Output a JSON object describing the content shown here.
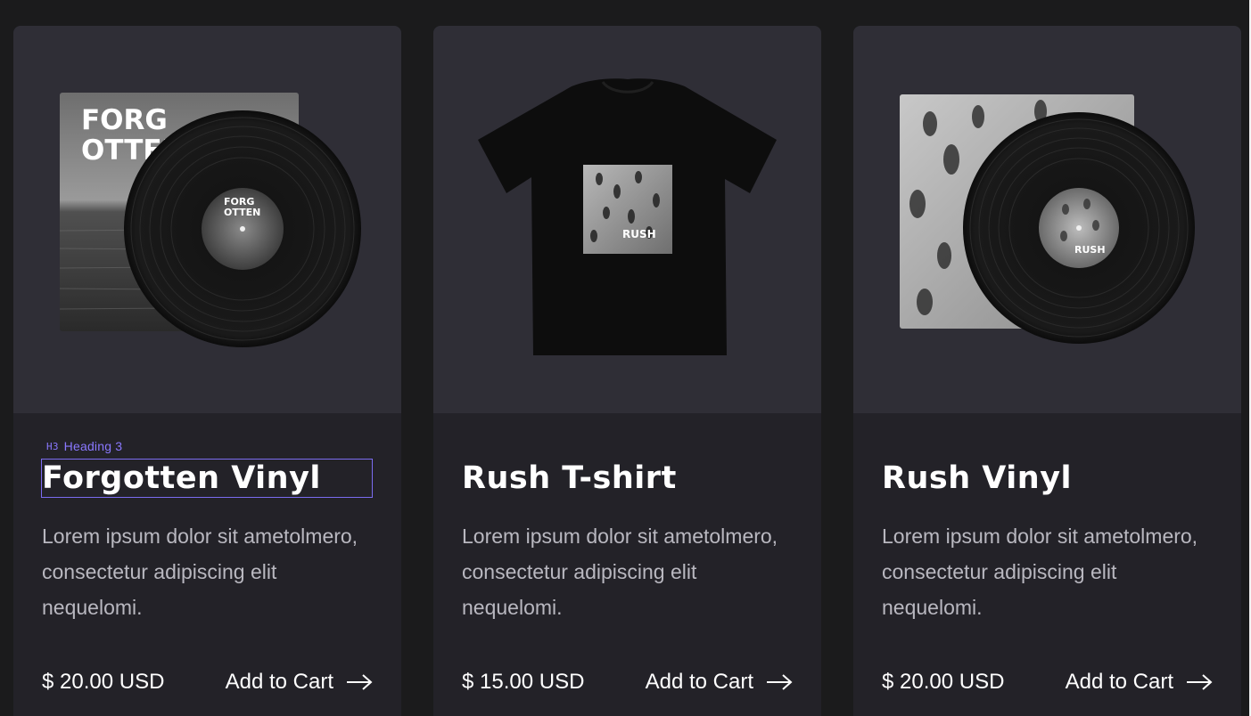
{
  "editor": {
    "tag_badge": "H3",
    "tag_label": "Heading 3"
  },
  "products": [
    {
      "title": "Forgotten Vinyl",
      "description": "Lorem ipsum dolor sit ametolmero, consectetur adipiscing elit nequelomi.",
      "price": "$ 20.00 USD",
      "cta": "Add to Cart",
      "cover_text_line1": "FORG",
      "cover_text_line2": "OTTEN",
      "label_text_line1": "FORG",
      "label_text_line2": "OTTEN"
    },
    {
      "title": "Rush T-shirt",
      "description": "Lorem ipsum dolor sit ametolmero, consectetur adipiscing elit nequelomi.",
      "price": "$ 15.00 USD",
      "cta": "Add to Cart",
      "print_text": "RUSH"
    },
    {
      "title": "Rush Vinyl",
      "description": "Lorem ipsum dolor sit ametolmero, consectetur adipiscing elit nequelomi.",
      "price": "$ 20.00 USD",
      "cta": "Add to Cart",
      "label_text": "RUSH"
    }
  ],
  "icons": {
    "cart_arrow": "arrow-right-icon"
  },
  "colors": {
    "page_bg": "#1b1b1c",
    "card_bg": "#232228",
    "media_bg": "#2f2e36",
    "accent": "#7b6cf0",
    "text": "#ffffff",
    "muted": "#b9b8c0"
  }
}
